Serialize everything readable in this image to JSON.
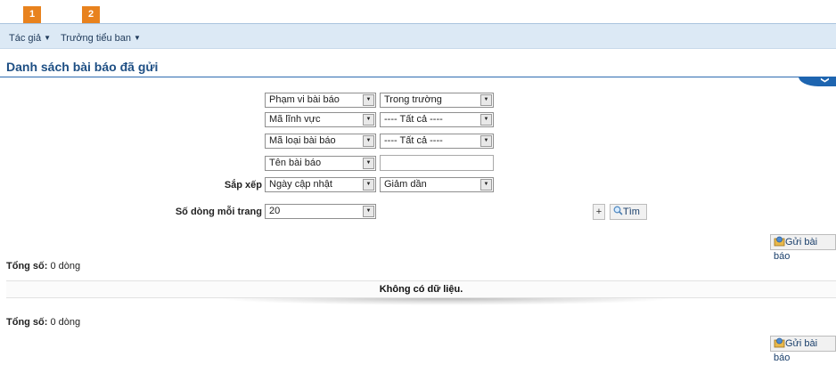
{
  "nav": {
    "badges": [
      "1",
      "2"
    ],
    "menu": [
      {
        "label": "Tác giả",
        "caret": "▼"
      },
      {
        "label": "Trưởng tiểu ban",
        "caret": "▼"
      }
    ]
  },
  "page": {
    "title": "Danh sách bài báo đã gửi",
    "collapse_glyph": "❯"
  },
  "filters": {
    "scope_field": "Phạm vi bài báo",
    "scope_value": "Trong trường",
    "field_field": "Mã lĩnh vực",
    "field_value": "---- Tất cả ----",
    "type_field": "Mã loại bài báo",
    "type_value": "---- Tất cả ----",
    "name_field": "Tên bài báo",
    "name_value": "",
    "sort_label": "Sắp xếp",
    "sort_by": "Ngày cập nhật",
    "sort_order": "Giảm dần",
    "rows_label": "Số dòng mỗi trang",
    "rows_value": "20",
    "arrow": "▼"
  },
  "actions": {
    "plus_label": "+",
    "search_label": "Tìm",
    "submit_label": "Gửi bài báo"
  },
  "results": {
    "total_label": "Tổng số:",
    "total_value": "0 dòng",
    "empty_message": "Không có dữ liệu."
  }
}
